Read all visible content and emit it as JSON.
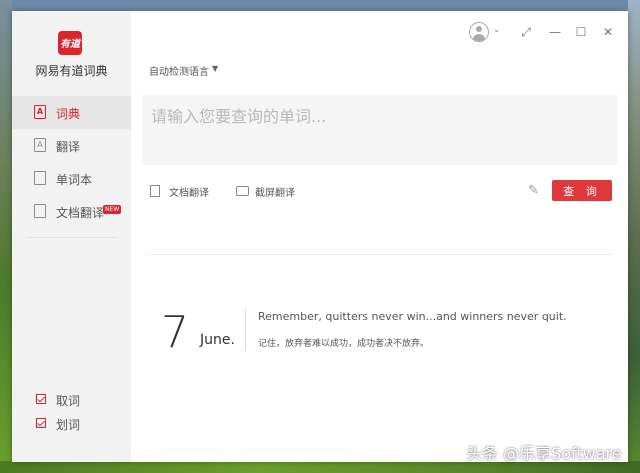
{
  "app": {
    "logo_text": "有道",
    "name": "网易有道词典"
  },
  "sidebar": {
    "items": [
      {
        "label": "词典",
        "icon": "dictionary-icon",
        "active": true
      },
      {
        "label": "翻译",
        "icon": "translate-icon"
      },
      {
        "label": "单词本",
        "icon": "wordbook-icon"
      },
      {
        "label": "文档翻译",
        "icon": "document-icon",
        "badge": "NEW"
      }
    ],
    "checks": [
      {
        "label": "取词",
        "checked": true
      },
      {
        "label": "划词",
        "checked": true
      }
    ]
  },
  "titlebar": {
    "controls": [
      "avatar",
      "pin-icon",
      "minimize-icon",
      "maximize-icon",
      "close-icon"
    ],
    "minimize": "—",
    "maximize": "☐",
    "close": "✕",
    "pin": "⤢"
  },
  "main": {
    "language_select": "自动检测语言",
    "search_placeholder": "请输入您要查询的单词...",
    "tools": {
      "doc_translate": "文档翻译",
      "screenshot_translate": "截屏翻译"
    },
    "query_button": "查 询"
  },
  "daily": {
    "day": "7",
    "month": "June.",
    "quote_en": "Remember, quitters never win...and winners never quit.",
    "quote_cn": "记住，放弃者难以成功，成功者决不放弃。"
  },
  "watermark": "头条 @乐享Software",
  "colors": {
    "accent": "#d9252b",
    "button": "#e0393b",
    "sidebar_bg": "#f2f2f2",
    "input_bg": "#f5f5f5"
  }
}
